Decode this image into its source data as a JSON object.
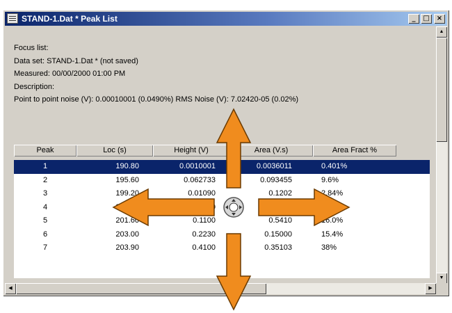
{
  "window": {
    "title": "STAND-1.Dat * Peak List",
    "min": "_",
    "max": "□",
    "close": "×"
  },
  "info": {
    "focus": "Focus list:",
    "dataset": "Data set: STAND-1.Dat * (not saved)",
    "measured": "Measured: 00/00/2000 01:00 PM",
    "description": "Description:",
    "noise": "Point to point noise (V): 0.00010001 (0.0490%)  RMS Noise (V): 7.02420-05 (0.02%)"
  },
  "table": {
    "headers": [
      "Peak",
      "Loc (s)",
      "Height (V)",
      "Area (V.s)",
      "Area Fract %"
    ],
    "rows": [
      [
        "1",
        "190.80",
        "0.0010001",
        "0.0036011",
        "0.401%"
      ],
      [
        "2",
        "195.60",
        "0.062733",
        "0.093455",
        "9.6%"
      ],
      [
        "3",
        "199.20",
        "0.01090",
        "0.1202",
        "2.84%"
      ],
      [
        "4",
        "200.40",
        "0.032000",
        "0.3020",
        "2.89%"
      ],
      [
        "5",
        "201.60",
        "0.1100",
        "0.5410",
        "16.0%"
      ],
      [
        "6",
        "203.00",
        "0.2230",
        "0.15000",
        "15.4%"
      ],
      [
        "7",
        "203.90",
        "0.4100",
        "0.35103",
        "38%"
      ]
    ],
    "selected_row": 0
  },
  "colors": {
    "arrow": "#f08c1e",
    "selection": "#0a246a"
  }
}
